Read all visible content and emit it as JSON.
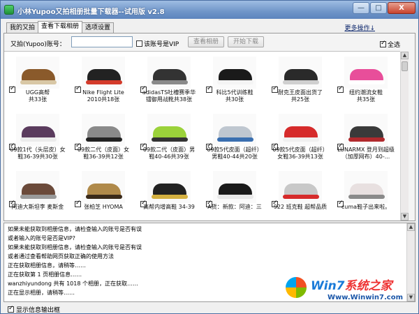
{
  "window": {
    "title": "小林Yupoo又拍相册批量下载器--试用版 v2.8",
    "min_label": "—",
    "max_label": "□",
    "close_label": "X"
  },
  "tabs": [
    {
      "label": "我的又拍"
    },
    {
      "label": "查看下载相册"
    },
    {
      "label": "选项设置"
    }
  ],
  "more_ops": "更多操作↓",
  "toolbar": {
    "account_label": "又拍(Yupoo)账号：",
    "account_value": "",
    "vip_label": "该账号是VIP",
    "view_button": "查看相册",
    "download_button": "开始下载",
    "select_all": "全选"
  },
  "albums": [
    {
      "l1": "UGG高帮",
      "l2": "共33张",
      "shoe": "#8a5a2b",
      "sole": "#d8c7a5",
      "checked": true
    },
    {
      "l1": "Nike Flight Lite",
      "l2": "2010共18张",
      "shoe": "#222222",
      "sole": "#d33a2a",
      "checked": true
    },
    {
      "l1": "adidasTS吐槽赛季华",
      "l2": "镭御用战靴共38张",
      "shoe": "#333333",
      "sole": "#8a8a8a",
      "checked": true
    },
    {
      "l1": "科比5代训练鞋",
      "l2": "共30张",
      "shoe": "#1a1a1a",
      "sole": "#f4f4f4",
      "checked": true
    },
    {
      "l1": "耐克王皮面出货了",
      "l2": "共25张",
      "shoe": "#2a2a2a",
      "sole": "#cfcfcf",
      "checked": true
    },
    {
      "l1": "纽约潮流女鞋",
      "l2": "共35张",
      "shoe": "#e84e9a",
      "sole": "#ffffff",
      "checked": true
    },
    {
      "l1": "09款1代（头层皮）女",
      "l2": "鞋36-39共30张",
      "shoe": "#5b3c5e",
      "sole": "#ececec",
      "checked": true
    },
    {
      "l1": "09款二代（皮面）女",
      "l2": "鞋36-39共12张",
      "shoe": "#8a8a8a",
      "sole": "#222222",
      "checked": true
    },
    {
      "l1": "09款二代（皮面）男",
      "l2": "鞋40-46共39张",
      "shoe": "#9bd23a",
      "sole": "#333333",
      "checked": true
    },
    {
      "l1": "09款5代皮面（超纤）",
      "l2": "男鞋40-44共20张",
      "shoe": "#bfc7d0",
      "sole": "#3a6fb0",
      "checked": true
    },
    {
      "l1": "09款5代皮面（超纤）",
      "l2": "女鞋36-39共13张",
      "shoe": "#d62b2b",
      "sole": "#f0f0f0",
      "checked": true
    },
    {
      "l1": "LUNARMX 登月到超级",
      "l2": "（加厚网布）40-...",
      "shoe": "#3a3a3a",
      "sole": "#b0292d",
      "checked": true
    },
    {
      "l1": "阿迪大斯坦李 麦斯金",
      "l2": "",
      "shoe": "#6b4a3a",
      "sole": "#9a9a9a",
      "checked": true
    },
    {
      "l1": "张柏芝 HYOMA",
      "l2": "",
      "shoe": "#b08a4a",
      "sole": "#3a2a1a",
      "checked": true
    },
    {
      "l1": "高帮内增高鞋 34-39",
      "l2": "",
      "shoe": "#222222",
      "sole": "#d4b040",
      "checked": true
    },
    {
      "l1": "A货：新款：阿迪：三",
      "l2": "",
      "shoe": "#1a1a1a",
      "sole": "#e8e8e8",
      "checked": true
    },
    {
      "l1": "922 班克鞋 超帮品质",
      "l2": "",
      "shoe": "#c8c8c8",
      "sole": "#d62b2b",
      "checked": true
    },
    {
      "l1": "cuma鞋子出来啦。",
      "l2": "",
      "shoe": "#e8e0e0",
      "sole": "#8a8a8a",
      "checked": true
    }
  ],
  "log": [
    "如果未能获取到相册信息，请检查输入的账号是否有误",
    "或者输入的账号是否是VIP?",
    "如果未能获取到相册信息，请检查输入的账号是否有误",
    "或者通过查看帮助网页获取正确的使用方法",
    "正在获取相册信息，请稍等……",
    "正在获取第 1 页相册信息……",
    "wanzhiyundong 共有 1018 个相册，正在获取……",
    "正在显示相册，请稍等……"
  ],
  "show_output_label": "显示信息输出框",
  "watermark": {
    "brand_a": "Win7",
    "brand_b": "系统之家",
    "url": "Www.Winwin7.com"
  }
}
